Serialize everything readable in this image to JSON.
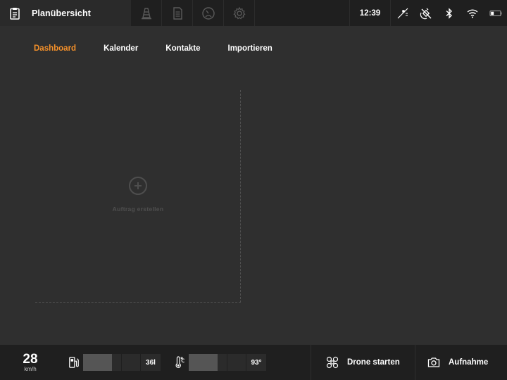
{
  "topbar": {
    "title": "Planübersicht",
    "tabs": [
      "traffic-cone",
      "document",
      "speedometer",
      "settings"
    ],
    "clock": "12:39"
  },
  "nav": {
    "items": [
      {
        "label": "Dashboard",
        "active": true
      },
      {
        "label": "Kalender",
        "active": false
      },
      {
        "label": "Kontakte",
        "active": false
      },
      {
        "label": "Importieren",
        "active": false
      }
    ]
  },
  "card": {
    "create_label": "Auftrag erstellen"
  },
  "bottombar": {
    "speed_value": "28",
    "speed_unit": "km/h",
    "fuel_value": "36l",
    "fuel_level": 0.37,
    "temp_value": "93°",
    "temp_level": 0.37,
    "drone_label": "Drone starten",
    "record_label": "Aufnahme"
  },
  "colors": {
    "accent": "#f4902a",
    "background": "#2f2f2f",
    "bar": "#1f1f1f"
  }
}
